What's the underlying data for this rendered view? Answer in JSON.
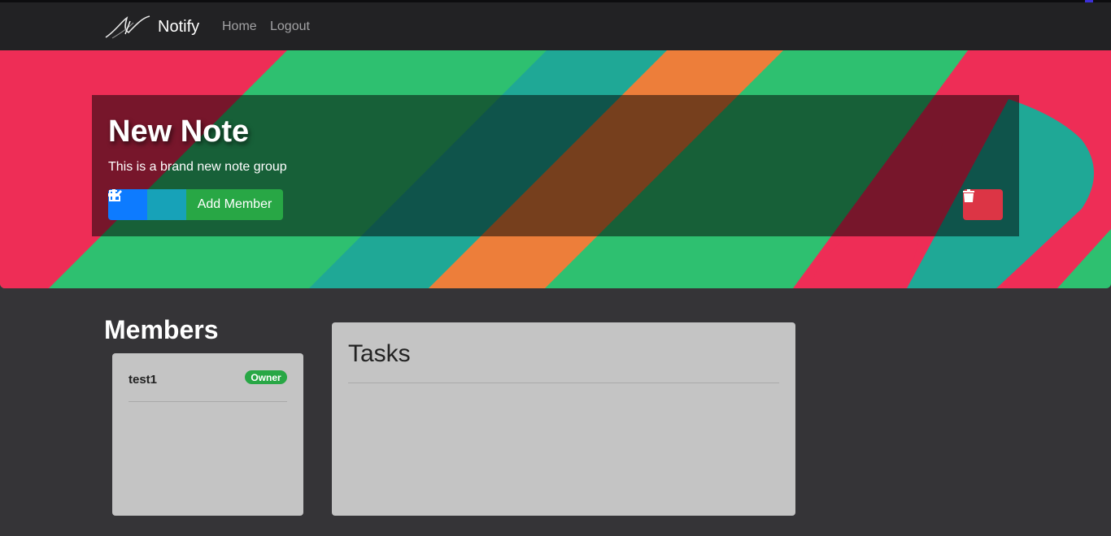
{
  "app": {
    "brand_name": "Notify"
  },
  "nav": {
    "home_label": "Home",
    "logout_label": "Logout"
  },
  "colors": {
    "navbar": "#222224",
    "page_background": "#353437",
    "stripe_green": "#2ec070",
    "stripe_red": "#ee2d56",
    "stripe_teal": "#1fa896",
    "stripe_orange": "#ed7e3a",
    "button_primary": "#0d7bff",
    "button_info": "#17a2b8",
    "button_success": "#28a745",
    "button_danger": "#dc3545",
    "card_background": "#c4c4c4"
  },
  "note": {
    "title": "New Note",
    "description": "This is a brand new note group",
    "actions": {
      "add_icon": "plus-icon",
      "edit_icon": "edit-icon",
      "add_member_label": "Add Member",
      "delete_icon": "trash-icon"
    }
  },
  "members": {
    "heading": "Members",
    "items": [
      {
        "name": "test1",
        "badge": "Owner"
      }
    ]
  },
  "tasks": {
    "title": "Tasks",
    "items": []
  }
}
